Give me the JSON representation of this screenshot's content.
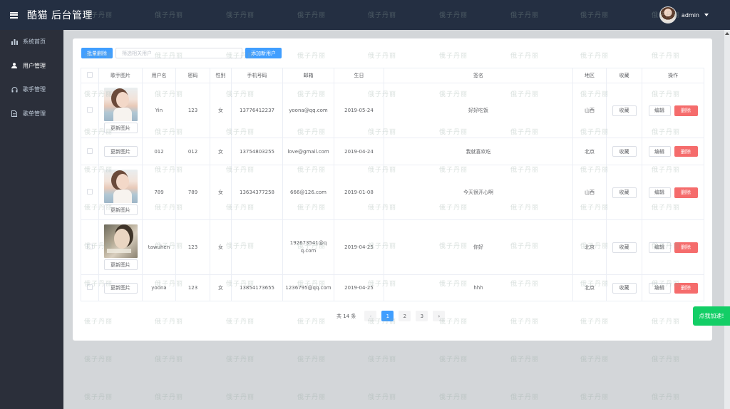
{
  "header": {
    "title": "酷猫 后台管理",
    "user": "admin"
  },
  "sidebar": {
    "items": [
      {
        "label": "系统首页",
        "icon": "bar-chart-icon"
      },
      {
        "label": "用户管理",
        "icon": "user-icon"
      },
      {
        "label": "歌手管理",
        "icon": "headphones-icon"
      },
      {
        "label": "歌单管理",
        "icon": "document-icon"
      }
    ],
    "active_index": 1
  },
  "toolbar": {
    "batch_delete_label": "批量删除",
    "search_placeholder": "筛选相关用户",
    "add_user_label": "添加新用户"
  },
  "table": {
    "columns": [
      "",
      "歌手图片",
      "用户名",
      "密码",
      "性别",
      "手机号码",
      "邮箱",
      "生日",
      "签名",
      "地区",
      "收藏",
      "操作"
    ],
    "update_photo_label": "更新图片",
    "favorite_label": "收藏",
    "edit_label": "编辑",
    "delete_label": "删除",
    "rows": [
      {
        "photo": "a",
        "username": "Yin",
        "password": "123",
        "gender": "女",
        "phone": "13776412237",
        "email": "yoona@qq.com",
        "birthday": "2019-05-24",
        "signature": "好好吃饭",
        "region": "山西"
      },
      {
        "photo": "",
        "username": "012",
        "password": "012",
        "gender": "女",
        "phone": "13754803255",
        "email": "love@gmail.com",
        "birthday": "2019-04-24",
        "signature": "我就喜欢吃",
        "region": "北京"
      },
      {
        "photo": "a",
        "username": "789",
        "password": "789",
        "gender": "女",
        "phone": "13634377258",
        "email": "666@126.com",
        "birthday": "2019-01-08",
        "signature": "今天很开心啊",
        "region": "山西"
      },
      {
        "photo": "b",
        "username": "tawuhen",
        "password": "123",
        "gender": "女",
        "phone": "",
        "email": "192673541@qq.com",
        "birthday": "2019-04-25",
        "signature": "你好",
        "region": "北京"
      },
      {
        "photo": "",
        "username": "yoona",
        "password": "123",
        "gender": "女",
        "phone": "13854173655",
        "email": "1236795@qq.com",
        "birthday": "2019-04-25",
        "signature": "hhh",
        "region": "北京"
      }
    ]
  },
  "pagination": {
    "total_label": "共 14 条",
    "pages": [
      "1",
      "2",
      "3"
    ],
    "current_page": 1
  },
  "float_button": "点我加速!",
  "watermark_text": "俄子丹丽",
  "colors": {
    "header_bg": "#242f42",
    "sidebar_bg": "#2b2f3a",
    "primary": "#409eff",
    "danger": "#f56c6c",
    "success": "#13ce66"
  }
}
